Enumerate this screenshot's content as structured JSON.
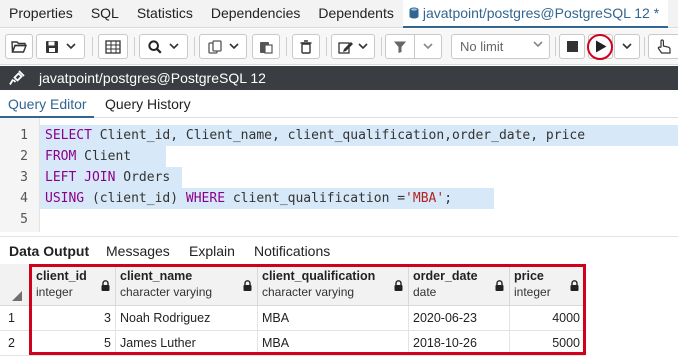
{
  "top_tabs": [
    {
      "label": "Properties"
    },
    {
      "label": "SQL"
    },
    {
      "label": "Statistics"
    },
    {
      "label": "Dependencies"
    },
    {
      "label": "Dependents"
    },
    {
      "label": "javatpoint/postgres@PostgreSQL 12 *",
      "active": true
    }
  ],
  "toolbar": {
    "limit_label": "No limit"
  },
  "connection": {
    "label": "javatpoint/postgres@PostgreSQL 12"
  },
  "editor_tabs": [
    {
      "label": "Query Editor",
      "active": true
    },
    {
      "label": "Query History"
    }
  ],
  "editor": {
    "line_numbers": [
      "1",
      "2",
      "3",
      "4",
      "5"
    ],
    "lines": [
      {
        "segments": [
          {
            "t": "SELECT",
            "k": "kw"
          },
          {
            "t": " Client_id, Client_name, client_qualification,order_date, price",
            "k": "txt"
          }
        ]
      },
      {
        "segments": [
          {
            "t": "FROM",
            "k": "kw"
          },
          {
            "t": " Client",
            "k": "txt"
          }
        ]
      },
      {
        "segments": [
          {
            "t": "LEFT JOIN",
            "k": "kw"
          },
          {
            "t": " Orders",
            "k": "txt"
          }
        ]
      },
      {
        "segments": [
          {
            "t": "USING",
            "k": "kw"
          },
          {
            "t": " (client_id) ",
            "k": "txt"
          },
          {
            "t": "WHERE",
            "k": "kw"
          },
          {
            "t": " client_qualification =",
            "k": "txt"
          },
          {
            "t": "'MBA'",
            "k": "str"
          },
          {
            "t": ";",
            "k": "txt"
          }
        ]
      },
      {
        "segments": []
      }
    ]
  },
  "output_tabs": [
    {
      "label": "Data Output",
      "active": true
    },
    {
      "label": "Messages"
    },
    {
      "label": "Explain"
    },
    {
      "label": "Notifications"
    }
  ],
  "results": {
    "columns": [
      {
        "name": "client_id",
        "type": "integer"
      },
      {
        "name": "client_name",
        "type": "character varying"
      },
      {
        "name": "client_qualification",
        "type": "character varying"
      },
      {
        "name": "order_date",
        "type": "date"
      },
      {
        "name": "price",
        "type": "integer"
      }
    ],
    "rows": [
      {
        "row_number": "1",
        "cells": [
          "3",
          "Noah Rodriguez",
          "MBA",
          "2020-06-23",
          "4000"
        ]
      },
      {
        "row_number": "2",
        "cells": [
          "5",
          "James Luther",
          "MBA",
          "2018-10-26",
          "5000"
        ]
      }
    ]
  },
  "colors": {
    "accent": "#326690",
    "highlight_border": "#d0021b",
    "selection": "#d7e9f8",
    "keyword": "#8b008b",
    "string": "#b22222"
  }
}
